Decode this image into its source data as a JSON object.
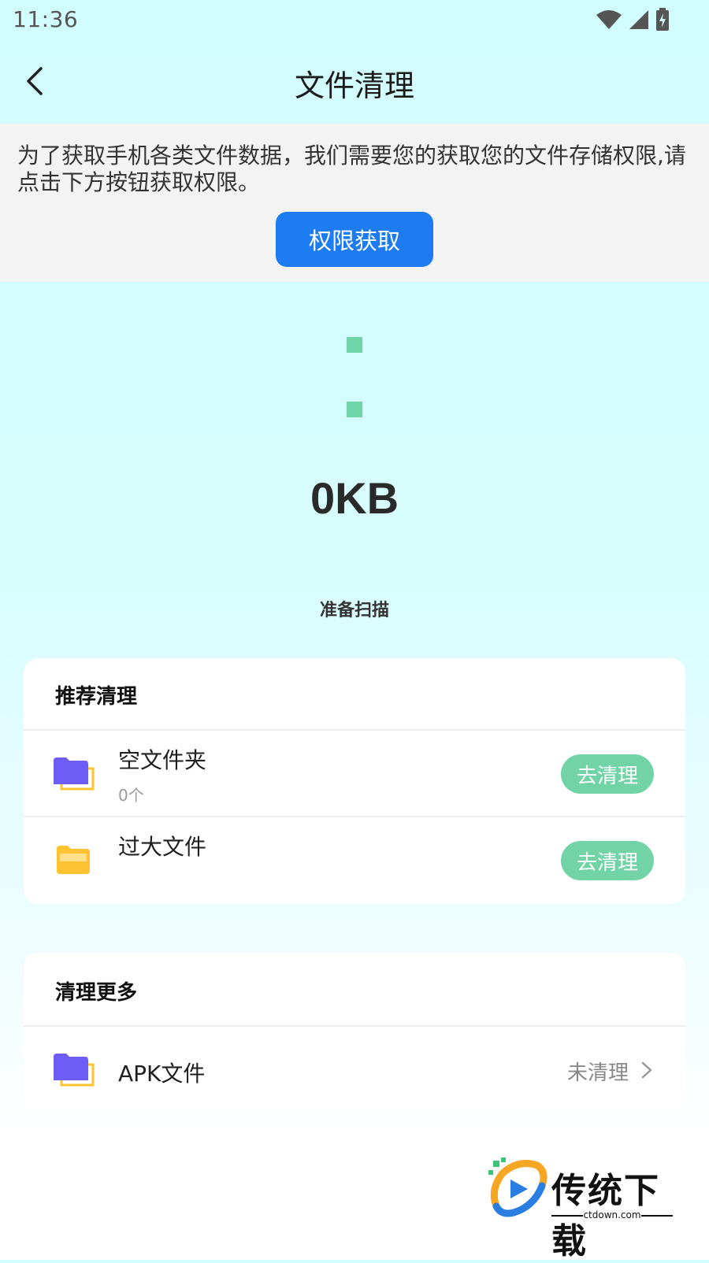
{
  "status_bar": {
    "time": "11:36",
    "icons": [
      "wifi-icon",
      "signal-icon",
      "battery-icon"
    ]
  },
  "header": {
    "title": "文件清理",
    "back_icon": "back-arrow-icon"
  },
  "permission": {
    "message": "为了获取手机各类文件数据，我们需要您的获取您的文件存储权限,请点击下方按钮获取权限。",
    "button_label": "权限获取"
  },
  "scan": {
    "size": "0KB",
    "status": "准备扫描"
  },
  "recommended": {
    "title": "推荐清理",
    "items": [
      {
        "name": "空文件夹",
        "count": "0个",
        "action": "去清理",
        "icon": "folder-purple-icon"
      },
      {
        "name": "过大文件",
        "count": "",
        "action": "去清理",
        "icon": "folder-yellow-icon"
      }
    ]
  },
  "more": {
    "title": "清理更多",
    "items": [
      {
        "name": "APK文件",
        "status": "未清理",
        "icon": "folder-purple-icon"
      }
    ]
  },
  "watermark": {
    "text": "传统下载",
    "url": "ctdown.com"
  },
  "colors": {
    "accent_blue": "#1d7cf2",
    "accent_green": "#72d3a7",
    "folder_purple": "#6d5cf5",
    "folder_yellow": "#ffc233"
  }
}
